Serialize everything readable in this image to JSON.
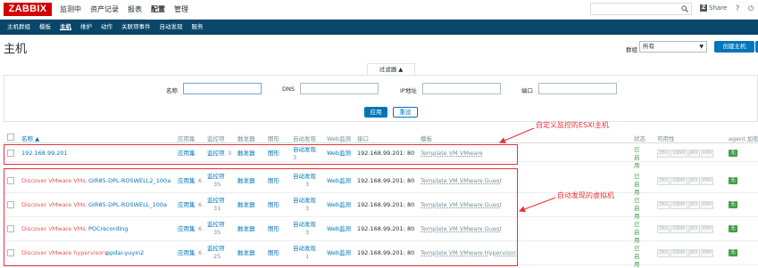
{
  "topbar": {
    "logo": "ZABBIX",
    "menu": [
      "监测中",
      "资产记录",
      "报表",
      "配置",
      "管理"
    ],
    "active_index": 3,
    "share": "Share",
    "share_mark": "Z",
    "help": "?",
    "user": "⏻"
  },
  "submenu": {
    "items": [
      "主机群组",
      "模板",
      "主机",
      "维护",
      "动作",
      "关联项事件",
      "自动发现",
      "服务"
    ],
    "active_index": 2
  },
  "page": {
    "title": "主机",
    "group_label": "群组",
    "group_value": "所有",
    "create_button": "创建主机"
  },
  "filter": {
    "tab_label": "过滤器 ▲",
    "name_label": "名称",
    "dns_label": "DNS",
    "ip_label": "IP地址",
    "port_label": "端口",
    "name_value": "",
    "dns_value": "",
    "ip_value": "",
    "port_value": "",
    "apply": "应用",
    "reset": "重设"
  },
  "table": {
    "headers": {
      "name": "名称 ▲",
      "apps": "应用集",
      "items": "监控项",
      "triggers": "触发器",
      "graphs": "图形",
      "discovery": "自动发现",
      "web": "Web监测",
      "interface": "接口",
      "templates": "模板",
      "status": "状态",
      "availability": "可用性",
      "agent_encryption": "agent 加密"
    },
    "rows": [
      {
        "prefix": "",
        "name": "192.168.99.201",
        "apps": "应用集",
        "apps_count": "",
        "items": "监控项",
        "items_count": "3",
        "triggers": "触发器",
        "graphs": "图形",
        "discovery": "自动发现",
        "discovery_count": "3",
        "web": "Web监测",
        "interface": "192.168.99.201: 80",
        "template": "Template VM VMware",
        "status": "已启用",
        "agent": "无"
      },
      {
        "prefix": "Discover VMware VMs:",
        "name": "GIR85-DPL-ROSWELL2_100a",
        "apps": "应用集",
        "apps_count": "6",
        "items": "监控项",
        "items_count": "35",
        "triggers": "触发器",
        "graphs": "图形",
        "discovery": "自动发现",
        "discovery_count": "3",
        "web": "Web监测",
        "interface": "192.168.99.201: 80",
        "template": "Template VM VMware Guest",
        "status": "已启用",
        "agent": "无"
      },
      {
        "prefix": "Discover VMware VMs:",
        "name": "GIR85-DPL-ROSWELL_100a",
        "apps": "应用集",
        "apps_count": "6",
        "items": "监控项",
        "items_count": "31",
        "triggers": "触发器",
        "graphs": "图形",
        "discovery": "自动发现",
        "discovery_count": "3",
        "web": "Web监测",
        "interface": "192.168.99.201: 80",
        "template": "Template VM VMware Guest",
        "status": "已启用",
        "agent": "无"
      },
      {
        "prefix": "Discover VMware VMs:",
        "name": "POCrecording",
        "apps": "应用集",
        "apps_count": "6",
        "items": "监控项",
        "items_count": "35",
        "triggers": "触发器",
        "graphs": "图形",
        "discovery": "自动发现",
        "discovery_count": "3",
        "web": "Web监测",
        "interface": "192.168.99.201: 80",
        "template": "Template VM VMware Guest",
        "status": "已启用",
        "agent": "无"
      },
      {
        "prefix": "Discover VMware hypervisors:",
        "name": "ppdai-yuyin2",
        "apps": "应用集",
        "apps_count": "6",
        "items": "监控项",
        "items_count": "25",
        "triggers": "触发器",
        "graphs": "图形",
        "discovery": "自动发现",
        "discovery_count": "1",
        "web": "Web监测",
        "interface": "192.168.99.201: 80",
        "template": "Template VM VMware Hypervisor",
        "status": "已启用",
        "agent": "无"
      }
    ],
    "availability_badges": [
      "ZBX",
      "SNMP",
      "JMX",
      "IPMI"
    ]
  },
  "annotations": {
    "esxi": "自定义监控的ESXI主机",
    "vms": "自动发现的虚拟机"
  },
  "colors": {
    "brand_red": "#d40000",
    "nav_blue": "#0a466a",
    "link_blue": "#0275b8",
    "annotation_red": "#e8333a",
    "enabled_green": "#429e47"
  }
}
